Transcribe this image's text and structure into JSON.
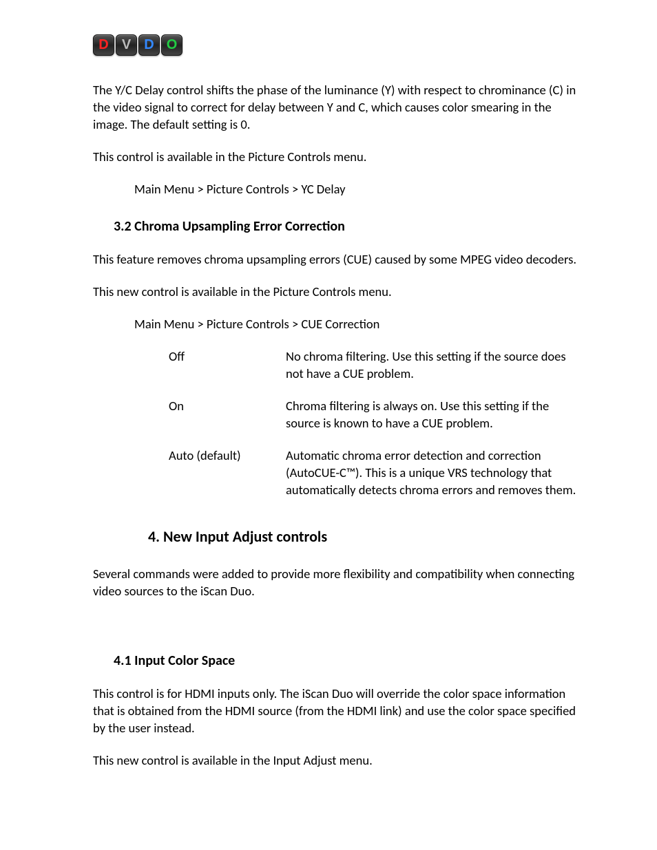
{
  "logo": {
    "d1": "D",
    "v": "V",
    "d2": "D",
    "o": "O"
  },
  "para1": "The Y/C Delay control shifts the phase of the luminance (Y) with respect to chrominance (C) in the video signal to correct for delay between Y and C, which causes color smearing in the image.  The default setting is 0.",
  "para2": "This control is available in the Picture Controls menu.",
  "breadcrumb1": "Main Menu > Picture Controls > YC Delay",
  "heading32": "3.2 Chroma Upsampling Error Correction",
  "para3": "This feature removes chroma upsampling errors (CUE) caused by some MPEG video decoders.",
  "para4": "This new control is available in the Picture Controls menu.",
  "breadcrumb2": "Main Menu > Picture Controls > CUE Correction",
  "options": [
    {
      "label": "Off",
      "desc": "No chroma filtering. Use this setting if the source does not have a CUE problem."
    },
    {
      "label": "On",
      "desc": "Chroma filtering is always on. Use this setting if the source is known to have a CUE problem."
    },
    {
      "label": "Auto (default)",
      "desc": "Automatic chroma error detection and correction (AutoCUE-C™).  This is a unique VRS technology that automatically detects chroma errors and removes them."
    }
  ],
  "heading4": "4.  New Input Adjust controls",
  "para5": "Several commands were added to provide more flexibility and compatibility when connecting video sources to the iScan Duo.",
  "heading41": "4.1 Input Color Space",
  "para6": "This control is for HDMI inputs only.  The iScan Duo will override the color space information that is obtained from the HDMI source (from the HDMI link) and use the color space specified by the user instead.",
  "para7": "This new control is available in the Input Adjust menu."
}
